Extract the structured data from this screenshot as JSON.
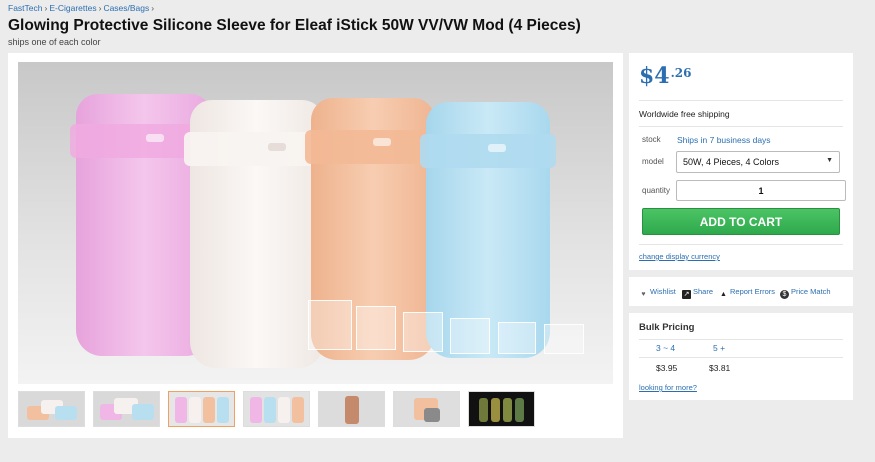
{
  "breadcrumb": [
    "FastTech",
    "E-Cigarettes",
    "Cases/Bags"
  ],
  "breadcrumb_separator": "›",
  "product": {
    "title": "Glowing Protective Silicone Sleeve for Eleaf iStick 50W VV/VW Mod (4 Pieces)",
    "subtitle": "ships one of each color"
  },
  "gallery": {
    "thumbnail_count": 7,
    "active_thumbnail": 2
  },
  "buybox": {
    "price_main": "$4",
    "price_cents": ".26",
    "shipping": "Worldwide free shipping",
    "stock_label": "stock",
    "stock_value": "Ships in 7 business days",
    "model_label": "model",
    "model_selected": "50W, 4 Pieces, 4 Colors",
    "quantity_label": "quantity",
    "quantity_value": "1",
    "add_to_cart": "ADD TO CART",
    "change_currency": "change display currency"
  },
  "actions": {
    "wishlist": "Wishlist",
    "share": "Share",
    "report": "Report Errors",
    "price_match": "Price Match"
  },
  "bulk_pricing": {
    "title": "Bulk Pricing",
    "tiers": [
      {
        "qty": "3 ~ 4",
        "price": "$3.95"
      },
      {
        "qty": "5 +",
        "price": "$3.81"
      }
    ],
    "more_link": "looking for more?"
  },
  "colors": {
    "link": "#2c6fb0",
    "cart_button": "#35b152",
    "pink": "#f0b6e6",
    "white": "#f6f1ee",
    "orange": "#f3c09f",
    "blue": "#b8dff0"
  }
}
